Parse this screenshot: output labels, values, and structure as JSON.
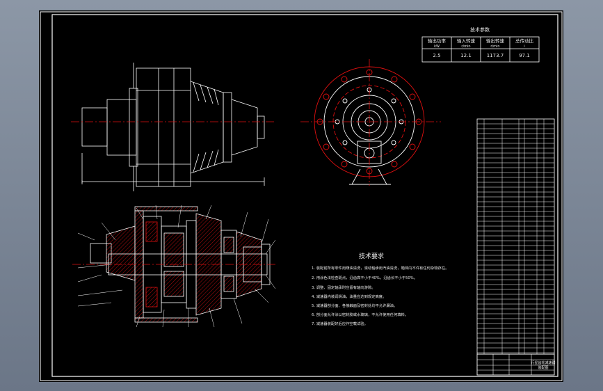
{
  "drawing": {
    "params_title": "技术参数",
    "params_headers": [
      "输出功率",
      "输入转速",
      "输出转速",
      "总传动比"
    ],
    "params_units": [
      "kW",
      "r/min",
      "r/min",
      "i"
    ],
    "params_values": [
      "2.5",
      "12.1",
      "1173.7",
      "97.1"
    ],
    "tech_title": "技术要求",
    "tech_notes": [
      "1. 装配前所有零件用煤油清洗，滚动轴承用汽油清洗，箱体内不许有任何杂物存在。",
      "2. 用涂色法检查斑点，沿齿高不小于40%，沿齿长不小于50%。",
      "3. 调整、固定轴承时应留有轴向游隙。",
      "4. 减速器内装润滑油，油量应达到规定高度。",
      "5. 减速器剖分面、各接触面及密封处均不允许漏油。",
      "6. 剖分面允许涂以密封胶或水玻璃，不允许使用任何填料。",
      "7. 减速器装配好后应作空载试验。"
    ],
    "title_block_name": "行星齿轮减速器",
    "title_block_sub": "装配图"
  },
  "colors": {
    "background": "#000000",
    "lines": "#ffffff",
    "centerline": "#e01010",
    "hatch": "#e01010"
  }
}
